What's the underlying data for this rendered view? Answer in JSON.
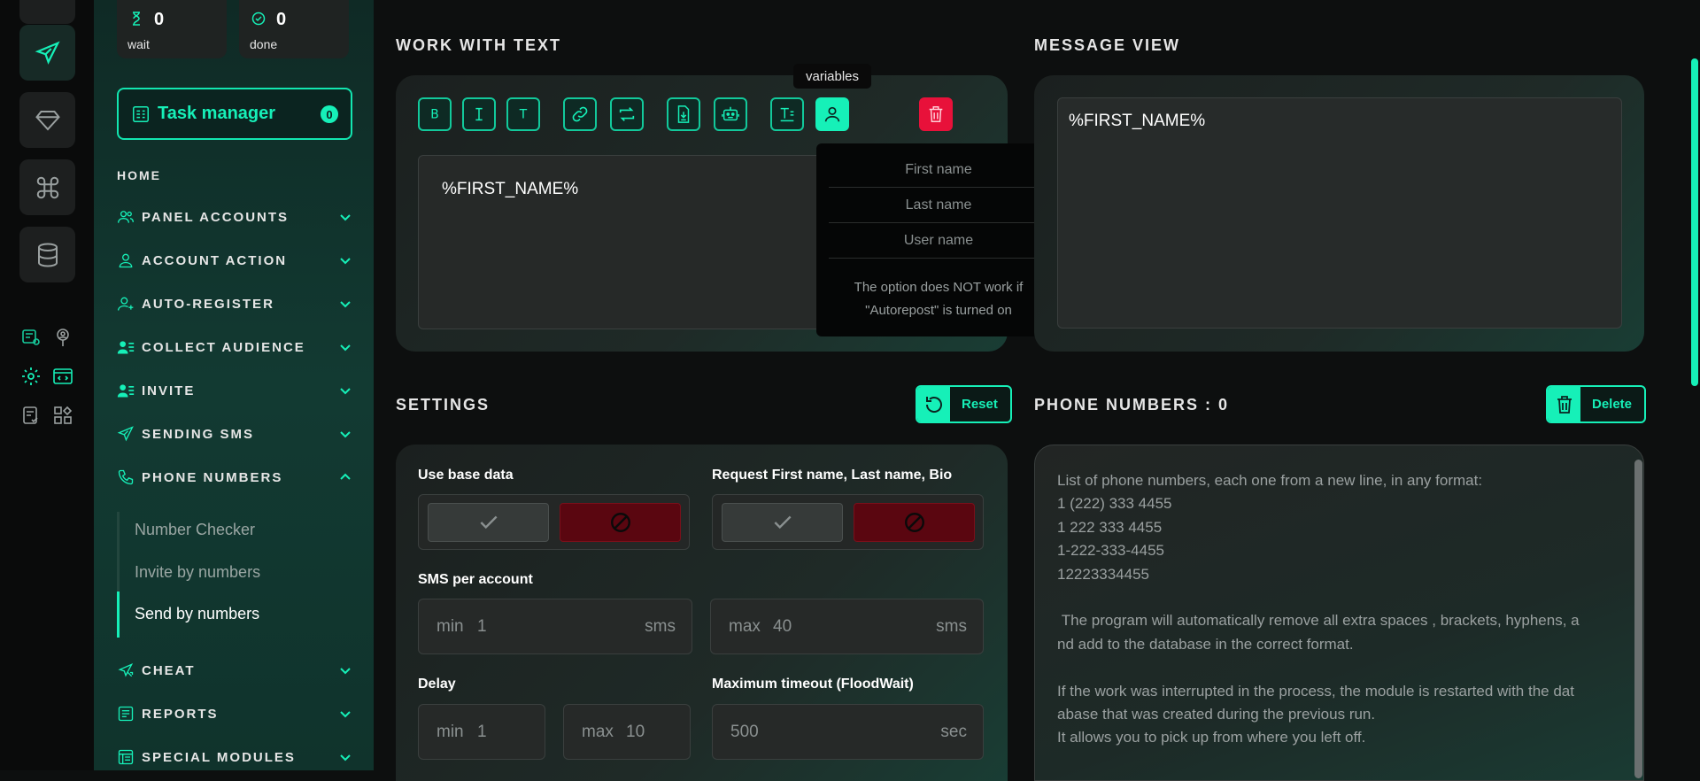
{
  "counters": {
    "wait": {
      "value": "0",
      "label": "wait"
    },
    "done": {
      "value": "0",
      "label": "done"
    }
  },
  "task_manager": {
    "label": "Task manager",
    "count": "0"
  },
  "nav": {
    "home": "HOME",
    "items": [
      {
        "label": "PANEL ACCOUNTS",
        "icon": "users-icon"
      },
      {
        "label": "ACCOUNT ACTION",
        "icon": "user-icon"
      },
      {
        "label": "AUTO-REGISTER",
        "icon": "user-plus-icon"
      },
      {
        "label": "COLLECT AUDIENCE",
        "icon": "user-list-icon"
      },
      {
        "label": "INVITE",
        "icon": "user-list-icon"
      },
      {
        "label": "SENDING SMS",
        "icon": "send-icon"
      },
      {
        "label": "PHONE NUMBERS",
        "icon": "phone-icon"
      },
      {
        "label": "CHEAT",
        "icon": "cheat-icon"
      },
      {
        "label": "REPORTS",
        "icon": "reports-icon"
      },
      {
        "label": "SPECIAL MODULES",
        "icon": "modules-icon"
      }
    ],
    "sub_items": [
      "Number Checker",
      "Invite by numbers",
      "Send by numbers"
    ]
  },
  "work_with_text": {
    "title": "WORK WITH TEXT",
    "tooltip": "variables",
    "editor_text": "%FIRST_NAME%",
    "toolbar_icons": [
      "bold-icon",
      "italic-icon",
      "text-icon",
      "link-icon",
      "repost-icon",
      "file-download-icon",
      "robot-icon",
      "text-format-icon",
      "variables-user-icon",
      "trash-icon"
    ],
    "toolbar_letters": {
      "bold": "B",
      "italic": "I",
      "text": "T"
    },
    "variables": [
      "First name",
      "Last name",
      "User name"
    ],
    "variables_note": "The option does NOT work if \"Autorepost\" is turned on"
  },
  "message_view": {
    "title": "MESSAGE VIEW",
    "text": "%FIRST_NAME%"
  },
  "settings": {
    "title": "SETTINGS",
    "reset_label": "Reset",
    "use_base_data": "Use base data",
    "request_names": "Request First name, Last name, Bio",
    "sms_per_account": "SMS per account",
    "sms_min_prefix": "min",
    "sms_min": "1",
    "sms_max_prefix": "max",
    "sms_max": "40",
    "sms_unit": "sms",
    "delay": "Delay",
    "delay_min_prefix": "min",
    "delay_min": "1",
    "delay_max_prefix": "max",
    "delay_max": "10",
    "timeout": "Maximum timeout (FloodWait)",
    "timeout_value": "500",
    "timeout_unit": "sec"
  },
  "phone_numbers": {
    "title": "PHONE NUMBERS : 0",
    "delete_label": "Delete",
    "placeholder": "List of phone numbers, each one from a new line, in any format:\n1 (222) 333 4455\n1 222 333 4455\n1-222-333-4455\n12223334455\n\n The program will automatically remove all extra spaces , brackets, hyphens, a\nnd add to the database in the correct format.\n\nIf the work was interrupted in the process, the module is restarted with the dat\nabase that was created during the previous run.\nIt allows you to pick up from where you left off."
  },
  "colors": {
    "accent": "#16f0b8",
    "danger": "#e8113a",
    "background": "#0d0f0f"
  }
}
